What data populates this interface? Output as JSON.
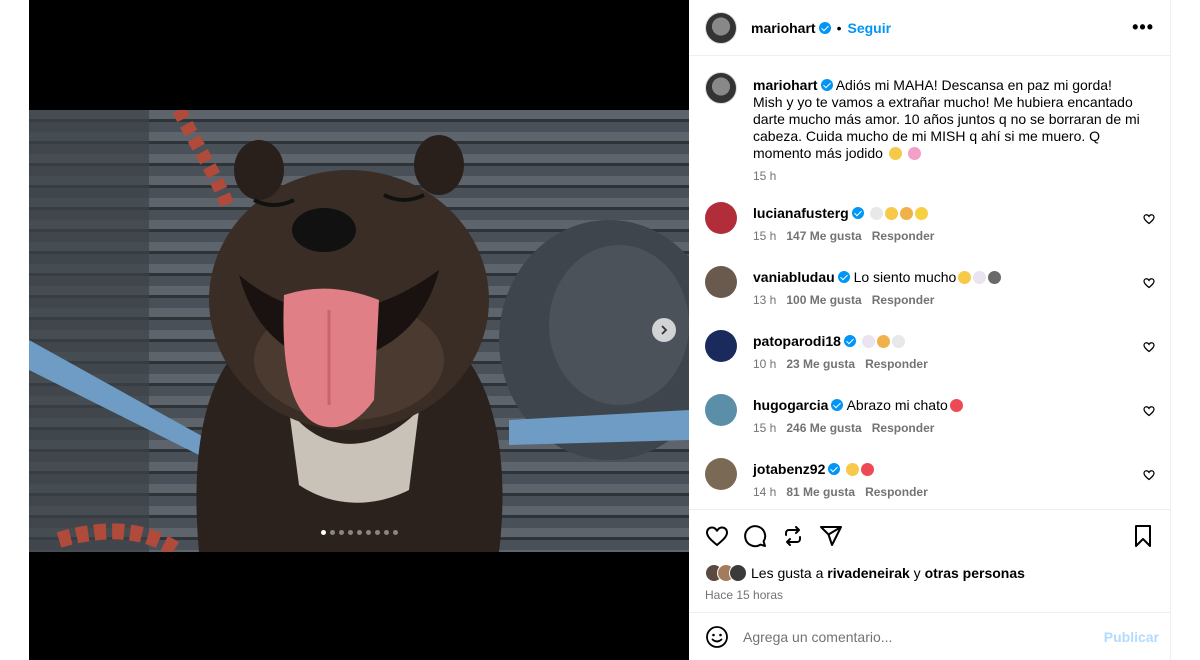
{
  "post": {
    "author": "mariohart",
    "follow_label": "Seguir",
    "separator": "•",
    "more_label": "•••"
  },
  "caption": {
    "username": "mariohart",
    "text": "Adiós mi MAHA! Descansa en paz mi gorda! Mish y yo te vamos a extrañar mucho! Me hubiera encantado darte mucho más amor. 10 años juntos q no se borraran de mi cabeza. Cuida mucho de mi MISH q ahí si me muero. Q momento más jodido",
    "emojis": [
      "😢",
      "😭"
    ],
    "time": "15 h"
  },
  "comments": [
    {
      "username": "lucianafusterg",
      "text": "",
      "emojis": [
        "🕊",
        "🥹",
        "🙏",
        "✨"
      ],
      "time": "15 h",
      "likes": "147 Me gusta",
      "reply": "Responder",
      "avatar_color": "#b22d3a"
    },
    {
      "username": "vaniabludau",
      "text": "Lo siento mucho",
      "emojis": [
        "🥹",
        "🤍",
        "🐾"
      ],
      "time": "13 h",
      "likes": "100 Me gusta",
      "reply": "Responder",
      "avatar_color": "#6a5a4e"
    },
    {
      "username": "patoparodi18",
      "text": "",
      "emojis": [
        "🤍",
        "🙏",
        "🕊"
      ],
      "time": "10 h",
      "likes": "23 Me gusta",
      "reply": "Responder",
      "avatar_color": "#1b2a5c"
    },
    {
      "username": "hugogarcia",
      "text": "Abrazo mi chato",
      "emojis": [
        "❤️"
      ],
      "time": "15 h",
      "likes": "246 Me gusta",
      "reply": "Responder",
      "avatar_color": "#5b8fa8"
    },
    {
      "username": "jotabenz92",
      "text": "",
      "emojis": [
        "😔",
        "❤️"
      ],
      "time": "14 h",
      "likes": "81 Me gusta",
      "reply": "Responder",
      "avatar_color": "#7a6a55"
    }
  ],
  "likes_line": {
    "prefix": "Les gusta a",
    "user": "rivadeneirak",
    "joiner": "y",
    "others": "otras personas"
  },
  "posted_ago": "Hace 15 horas",
  "comment_box": {
    "placeholder": "Agrega un comentario...",
    "publish_label": "Publicar"
  },
  "carousel": {
    "slide_count": 9,
    "active_index": 0
  },
  "colors": {
    "accent": "#0095f6",
    "publish_disabled": "#b3dbff",
    "like_heart": "#ed4956"
  }
}
